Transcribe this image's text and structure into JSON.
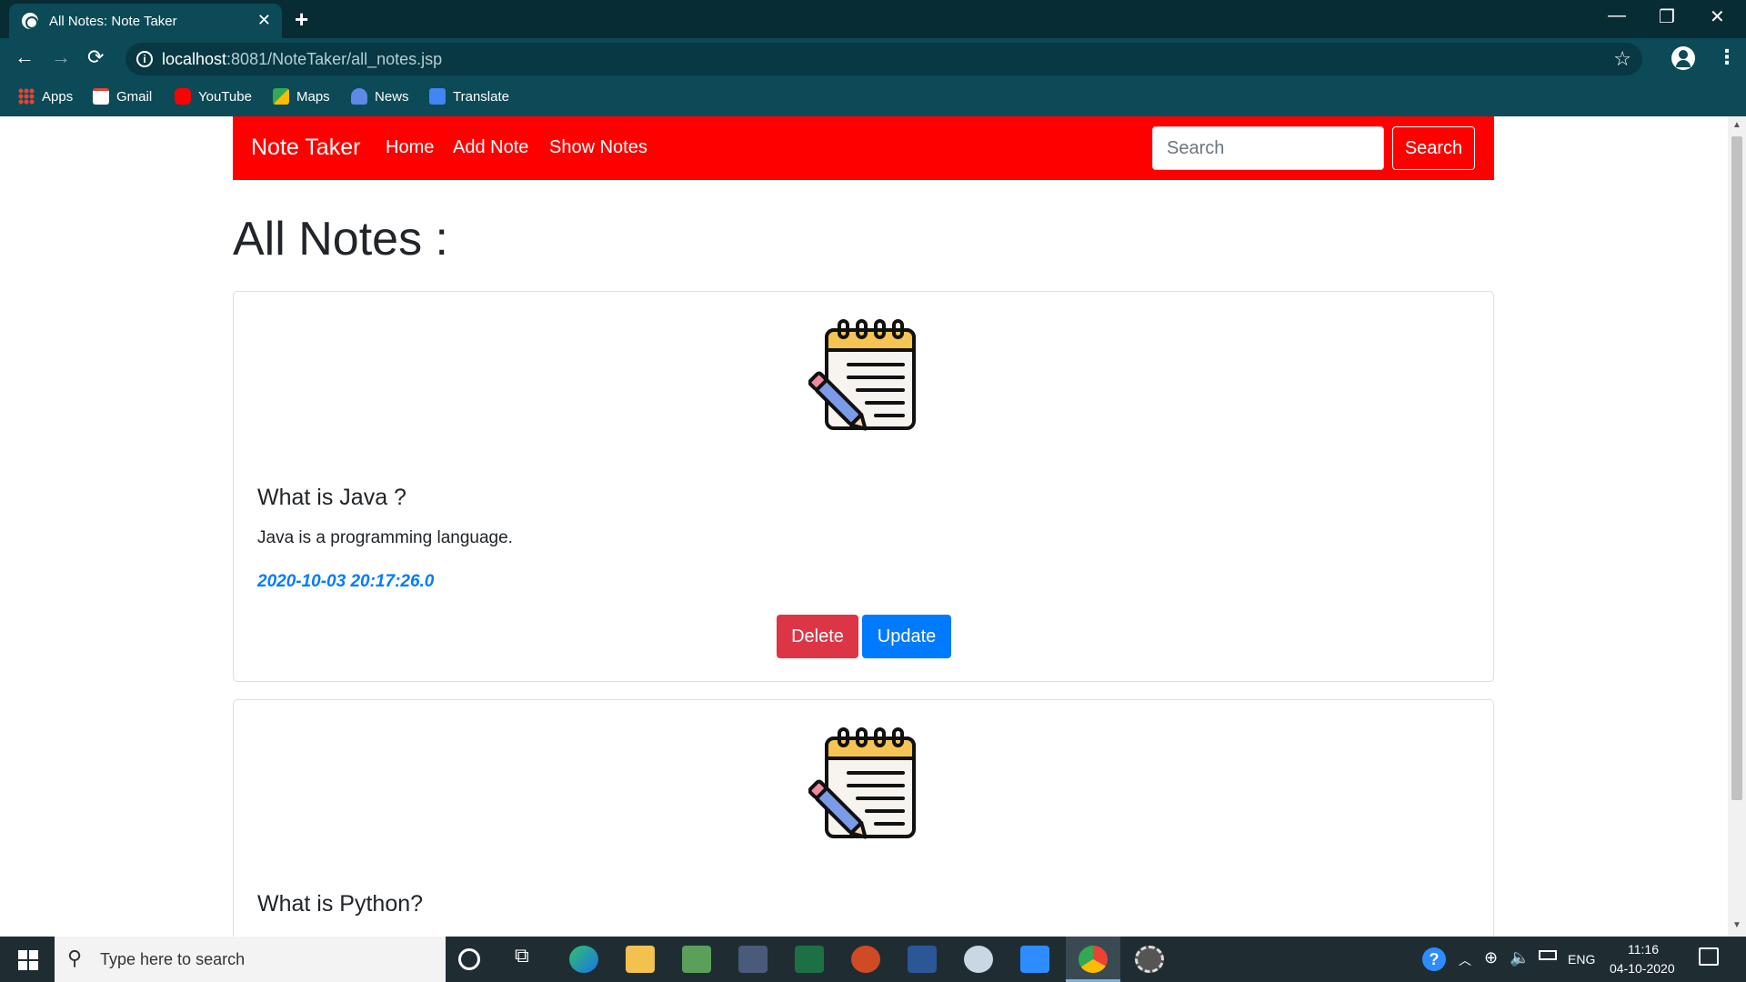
{
  "browser": {
    "tab_title": "All Notes: Note Taker",
    "url_host": "localhost",
    "url_rest": ":8081/NoteTaker/all_notes.jsp",
    "bookmarks": [
      {
        "label": "Apps",
        "color": "#4285f4"
      },
      {
        "label": "Gmail",
        "color": "#ea4335"
      },
      {
        "label": "YouTube",
        "color": "#ff0000"
      },
      {
        "label": "Maps",
        "color": "#34a853"
      },
      {
        "label": "News",
        "color": "#5c8ae6"
      },
      {
        "label": "Translate",
        "color": "#4285f4"
      }
    ]
  },
  "navbar": {
    "brand": "Note Taker",
    "links": [
      "Home",
      "Add Note",
      "Show Notes"
    ],
    "search_placeholder": "Search",
    "search_button": "Search",
    "color": "#ff0000"
  },
  "page": {
    "title": "All Notes :"
  },
  "notes": [
    {
      "title": "What is Java ?",
      "content": "Java is a programming language.",
      "date": "2020-10-03 20:17:26.0",
      "delete_label": "Delete",
      "update_label": "Update"
    },
    {
      "title": "What is Python?"
    }
  ],
  "taskbar": {
    "search_placeholder": "Type here to search",
    "language": "ENG",
    "time": "11:16",
    "date": "04-10-2020"
  },
  "colors": {
    "delete": "#dc3545",
    "update": "#007bff",
    "date_text": "#007bff"
  }
}
